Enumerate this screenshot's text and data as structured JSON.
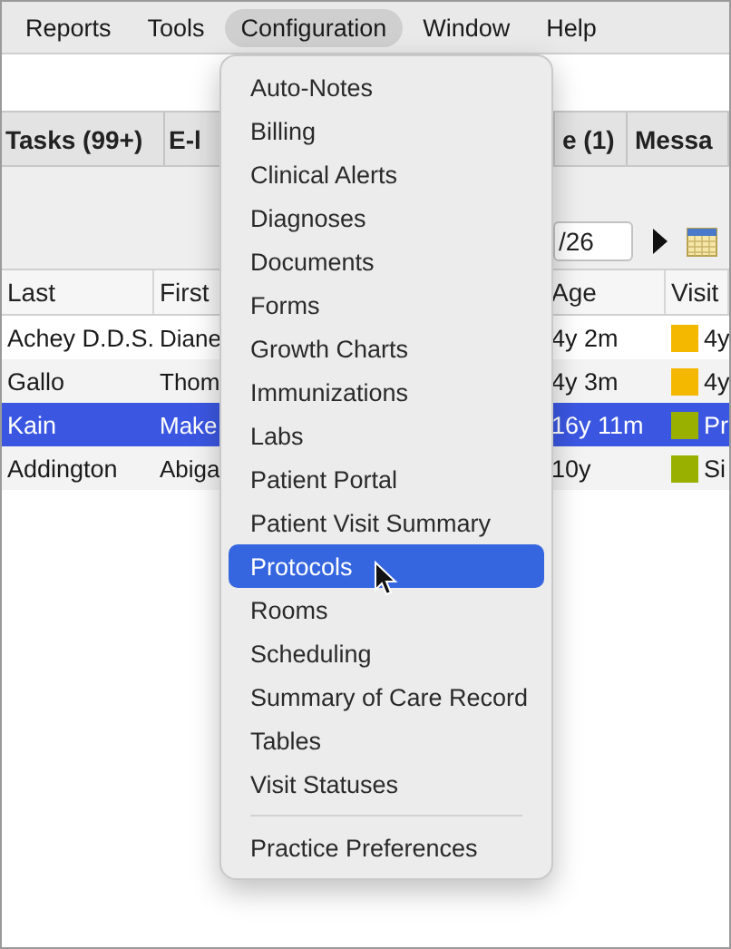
{
  "menu_bar": [
    {
      "label": "Reports",
      "selected": false
    },
    {
      "label": "Tools",
      "selected": false
    },
    {
      "label": "Configuration",
      "selected": true
    },
    {
      "label": "Window",
      "selected": false
    },
    {
      "label": "Help",
      "selected": false
    }
  ],
  "tabs": [
    {
      "label": "Tasks (99+)"
    },
    {
      "label": "E-l"
    },
    {
      "label": "e (1)"
    },
    {
      "label": "Messa"
    }
  ],
  "date_field": {
    "value": "/26"
  },
  "table": {
    "columns": [
      "Last",
      "First",
      "Age",
      "Visit"
    ],
    "rows": [
      {
        "last": "Achey D.D.S.",
        "first": "Diane",
        "age": "4y 2m",
        "visit": {
          "color": "#f5b800",
          "label": "4y"
        },
        "selected": false
      },
      {
        "last": "Gallo",
        "first": "Thom",
        "age": "4y 3m",
        "visit": {
          "color": "#f5b800",
          "label": "4y"
        },
        "selected": false
      },
      {
        "last": "Kain",
        "first": "Make",
        "age": "16y 11m",
        "visit": {
          "color": "#99b000",
          "label": "Pr"
        },
        "selected": true
      },
      {
        "last": "Addington",
        "first": "Abiga",
        "age": "10y",
        "visit": {
          "color": "#99b000",
          "label": "Si"
        },
        "selected": false
      }
    ]
  },
  "menu": {
    "items": [
      {
        "label": "Auto-Notes",
        "selected": false
      },
      {
        "label": "Billing",
        "selected": false
      },
      {
        "label": "Clinical Alerts",
        "selected": false
      },
      {
        "label": "Diagnoses",
        "selected": false
      },
      {
        "label": "Documents",
        "selected": false
      },
      {
        "label": "Forms",
        "selected": false
      },
      {
        "label": "Growth Charts",
        "selected": false
      },
      {
        "label": "Immunizations",
        "selected": false
      },
      {
        "label": "Labs",
        "selected": false
      },
      {
        "label": "Patient Portal",
        "selected": false
      },
      {
        "label": "Patient Visit Summary",
        "selected": false
      },
      {
        "label": "Protocols",
        "selected": true
      },
      {
        "label": "Rooms",
        "selected": false
      },
      {
        "label": "Scheduling",
        "selected": false
      },
      {
        "label": "Summary of Care Record",
        "selected": false
      },
      {
        "label": "Tables",
        "selected": false
      },
      {
        "label": "Visit Statuses",
        "selected": false
      }
    ],
    "bottom_items": [
      {
        "label": "Practice Preferences",
        "selected": false
      }
    ]
  }
}
